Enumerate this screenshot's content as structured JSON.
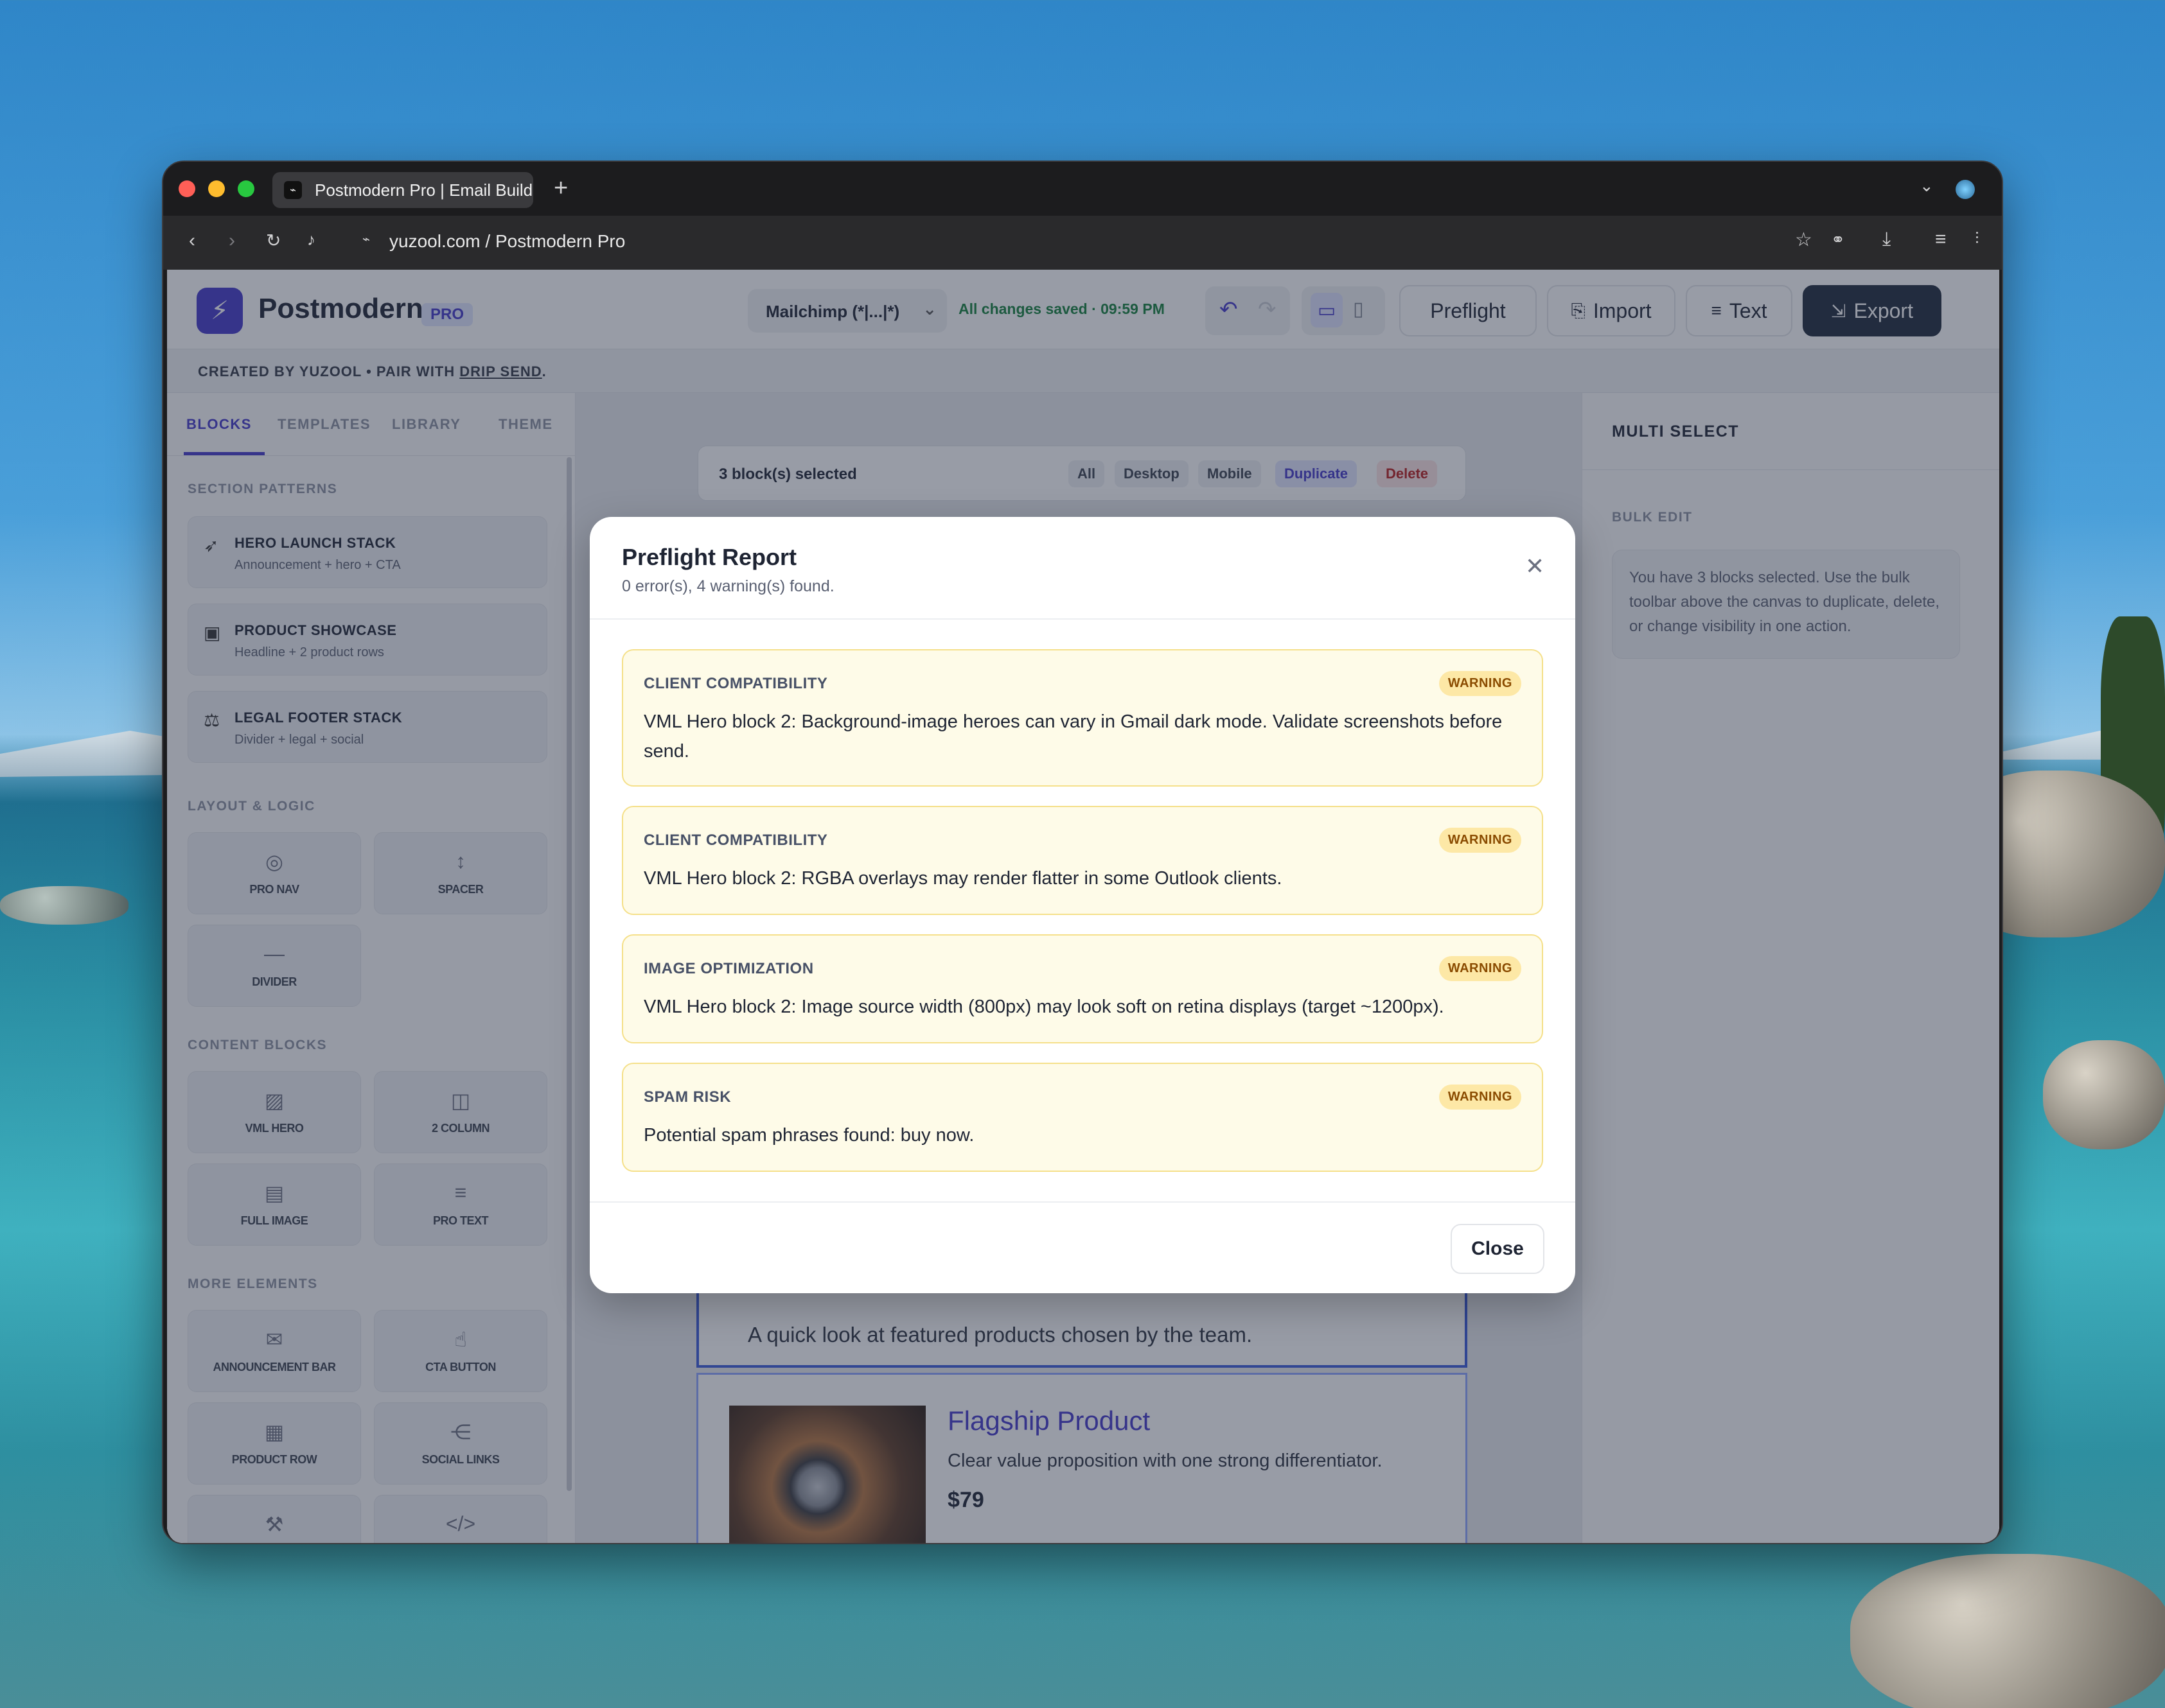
{
  "browser": {
    "tab_title": "Postmodern Pro | Email Builder",
    "new_tab": "+",
    "url": "yuzool.com / Postmodern Pro",
    "assistant": "Assistant"
  },
  "app": {
    "brand": "Postmodern",
    "badge": "PRO",
    "merge_tag": "Mailchimp (*|...|*)",
    "save_status": "All changes saved · 09:59 PM",
    "buttons": {
      "preflight": "Preflight",
      "import": "Import",
      "text": "Text",
      "export": "Export"
    },
    "subheader": {
      "prefix": "CREATED BY YUZOOL • PAIR WITH ",
      "link": "DRIP SEND",
      "suffix": "."
    }
  },
  "sidebar": {
    "tabs": [
      "BLOCKS",
      "TEMPLATES",
      "LIBRARY",
      "THEME"
    ],
    "section_patterns": "SECTION PATTERNS",
    "patterns": [
      {
        "title": "HERO LAUNCH STACK",
        "desc": "Announcement + hero + CTA"
      },
      {
        "title": "PRODUCT SHOWCASE",
        "desc": "Headline + 2 product rows"
      },
      {
        "title": "LEGAL FOOTER STACK",
        "desc": "Divider + legal + social"
      }
    ],
    "section_layout": "LAYOUT & LOGIC",
    "layout": [
      "PRO NAV",
      "SPACER",
      "DIVIDER"
    ],
    "section_content": "CONTENT BLOCKS",
    "content": [
      "VML HERO",
      "2 COLUMN",
      "FULL IMAGE",
      "PRO TEXT"
    ],
    "section_more": "MORE ELEMENTS",
    "more": [
      "ANNOUNCEMENT BAR",
      "CTA BUTTON",
      "PRODUCT ROW",
      "SOCIAL LINKS"
    ]
  },
  "canvas": {
    "selection": "3 block(s) selected",
    "bulk": [
      "All",
      "Desktop",
      "Mobile",
      "Duplicate",
      "Delete"
    ],
    "text_line": "A quick look at featured products chosen by the team.",
    "product": {
      "name": "Flagship Product",
      "desc": "Clear value proposition with one strong differentiator.",
      "price": "$79"
    }
  },
  "inspector": {
    "title": "MULTI SELECT",
    "section": "BULK EDIT",
    "note": "You have 3 blocks selected. Use the bulk toolbar above the canvas to duplicate, delete, or change visibility in one action."
  },
  "modal": {
    "title": "Preflight Report",
    "summary": "0 error(s), 4 warning(s) found.",
    "close": "Close",
    "items": [
      {
        "category": "CLIENT COMPATIBILITY",
        "level": "WARNING",
        "message": "VML Hero block 2: Background-image heroes can vary in Gmail dark mode. Validate screenshots before send."
      },
      {
        "category": "CLIENT COMPATIBILITY",
        "level": "WARNING",
        "message": "VML Hero block 2: RGBA overlays may render flatter in some Outlook clients."
      },
      {
        "category": "IMAGE OPTIMIZATION",
        "level": "WARNING",
        "message": "VML Hero block 2: Image source width (800px) may look soft on retina displays (target ~1200px)."
      },
      {
        "category": "SPAM RISK",
        "level": "WARNING",
        "message": "Potential spam phrases found: buy now."
      }
    ]
  }
}
